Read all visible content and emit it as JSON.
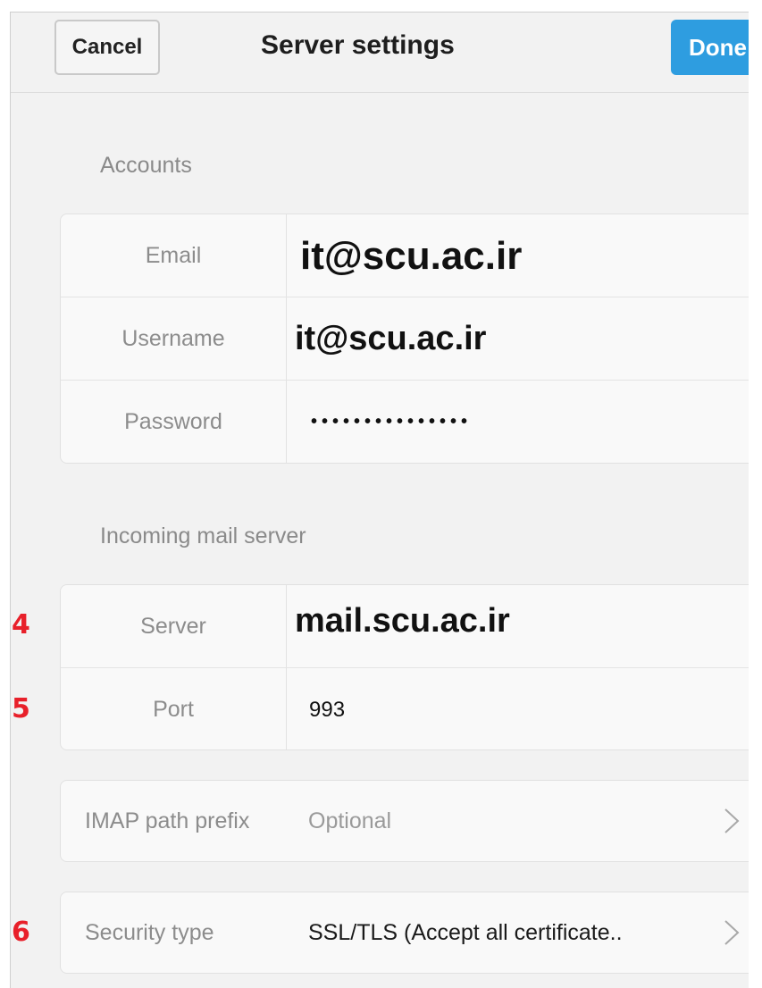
{
  "header": {
    "cancel_label": "Cancel",
    "title": "Server settings",
    "done_label": "Done",
    "accent_color": "#2e9de0"
  },
  "accounts": {
    "section_label": "Accounts",
    "rows": [
      {
        "label": "Email",
        "value": "it@scu.ac.ir"
      },
      {
        "label": "Username",
        "value": "it@scu.ac.ir"
      },
      {
        "label": "Password",
        "value": "•••••••••••••••"
      }
    ]
  },
  "incoming": {
    "section_label": "Incoming mail server",
    "rows": [
      {
        "label": "Server",
        "value": "mail.scu.ac.ir"
      },
      {
        "label": "Port",
        "value": "993"
      }
    ]
  },
  "imap_prefix": {
    "label": "IMAP path prefix",
    "placeholder": "Optional",
    "icon": "chevron-right-icon"
  },
  "security": {
    "label": "Security type",
    "value": "SSL/TLS (Accept all certificate..",
    "icon": "chevron-right-icon"
  },
  "annotations": {
    "server": "4",
    "port": "5",
    "security": "6",
    "color": "#e8202a"
  }
}
